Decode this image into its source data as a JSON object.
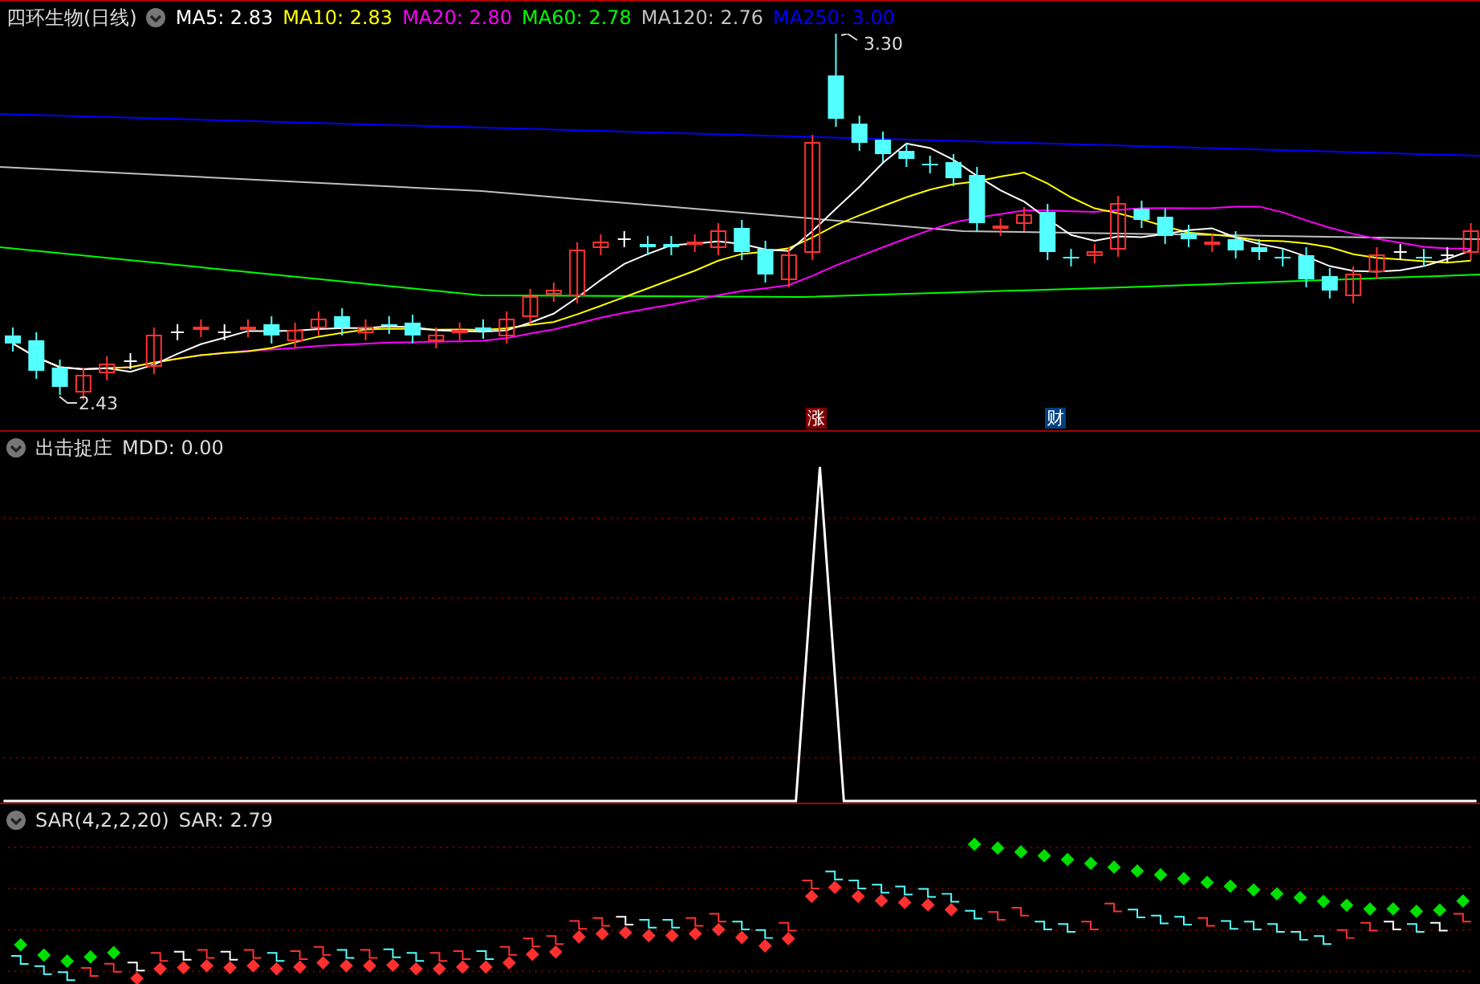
{
  "price_panel": {
    "title": "四环生物(日线)",
    "indicators": [
      {
        "label": "MA5: 2.83",
        "color": "#ffffff"
      },
      {
        "label": "MA10: 2.83",
        "color": "#ffff00"
      },
      {
        "label": "MA20: 2.80",
        "color": "#ff00ff"
      },
      {
        "label": "MA60: 2.78",
        "color": "#00ff00"
      },
      {
        "label": "MA120: 2.76",
        "color": "#c0c0c0"
      },
      {
        "label": "MA250: 3.00",
        "color": "#0000ff"
      }
    ],
    "high_label": "3.30",
    "low_label": "2.43",
    "markers": [
      {
        "text": "涨",
        "color": "#800000"
      },
      {
        "text": "财",
        "color": "#004080"
      }
    ]
  },
  "mdd_panel": {
    "title": "出击捉庄",
    "reading": "MDD: 0.00"
  },
  "sar_panel": {
    "title": "SAR(4,2,2,20)",
    "reading": "SAR: 2.79"
  }
}
